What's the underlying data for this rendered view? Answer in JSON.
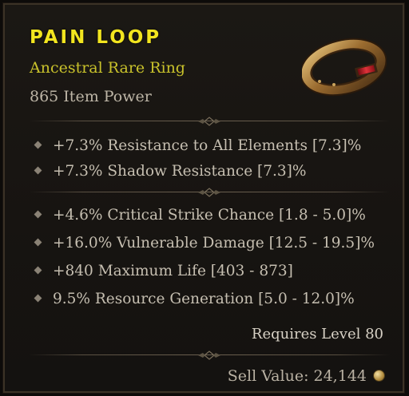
{
  "item": {
    "name": "PAIN LOOP",
    "rarity": "Ancestral Rare Ring",
    "power": "865 Item Power"
  },
  "implicits": [
    "+7.3% Resistance to All Elements [7.3]%",
    "+7.3% Shadow Resistance [7.3]%"
  ],
  "affixes": [
    "+4.6% Critical Strike Chance [1.8 - 5.0]%",
    "+16.0% Vulnerable Damage [12.5 - 19.5]%",
    "+840 Maximum Life [403 - 873]",
    "9.5% Resource Generation [5.0 - 12.0]%"
  ],
  "requirement": "Requires Level 80",
  "sell_value": "Sell Value: 24,144",
  "icons": {
    "item": "gold-ring-with-red-gem-icon",
    "bullet": "diamond-bullet-icon",
    "currency": "gold-coin-icon"
  },
  "colors": {
    "rare_title": "#f2e51f",
    "rare_subtitle": "#c9c22b",
    "body_text": "#c6bfb1",
    "panel_background": "#1b1814"
  }
}
